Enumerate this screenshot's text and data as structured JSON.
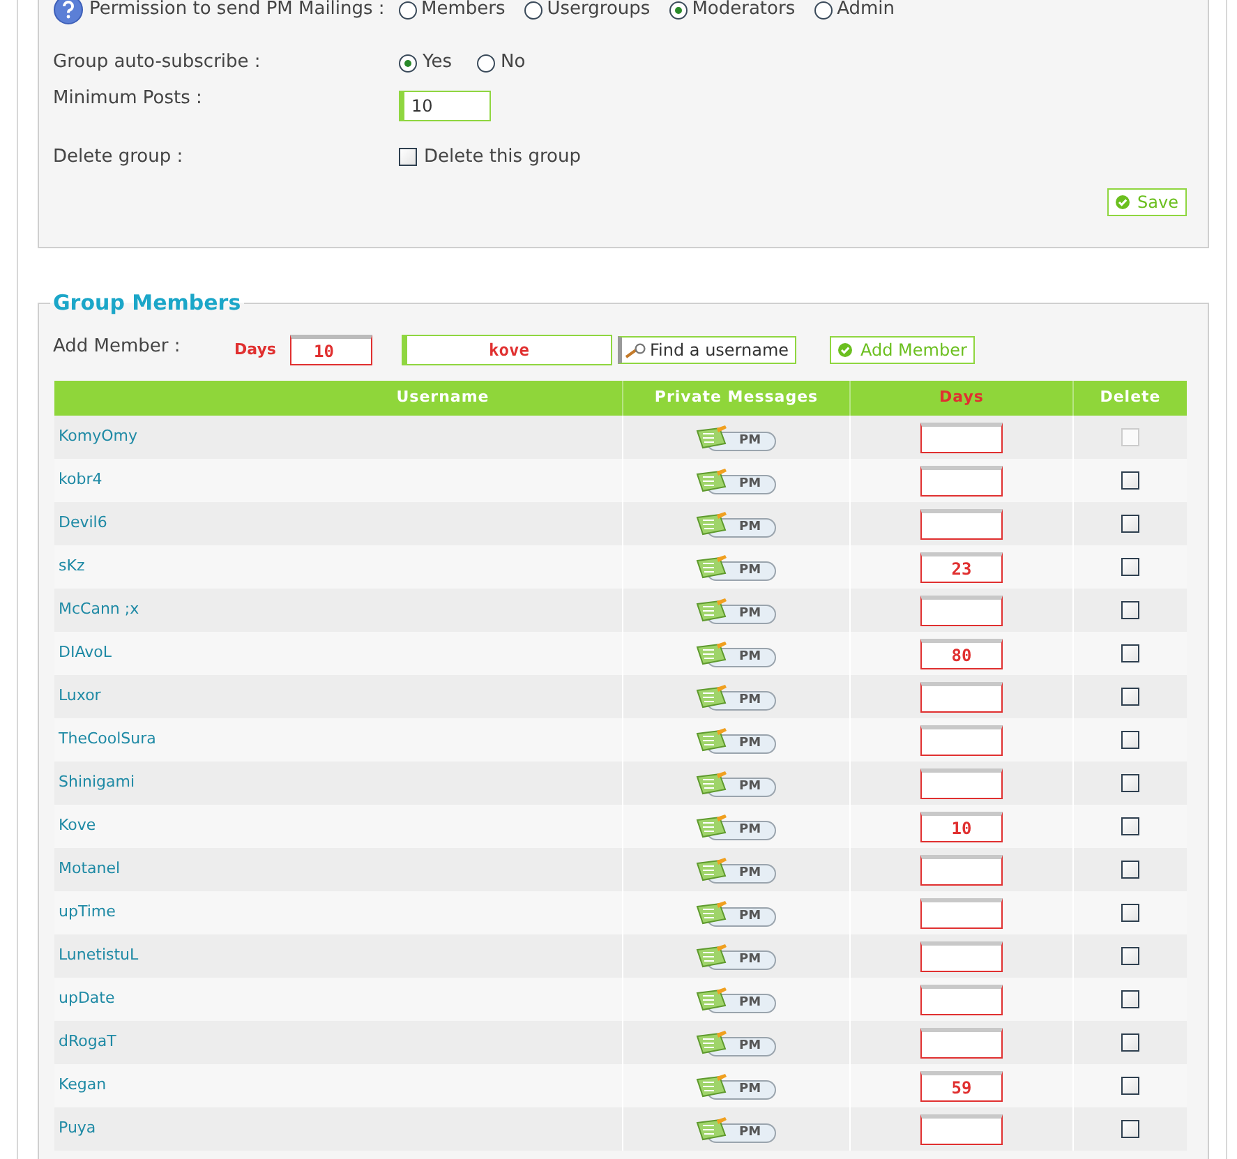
{
  "settings": {
    "permission": {
      "label": "Permission to send PM Mailings :",
      "options": [
        {
          "label": "Members",
          "selected": false
        },
        {
          "label": "Usergroups",
          "selected": false
        },
        {
          "label": "Moderators",
          "selected": true
        },
        {
          "label": "Admin",
          "selected": false
        }
      ]
    },
    "auto_subscribe": {
      "label": "Group auto-subscribe :",
      "options": [
        {
          "label": "Yes",
          "selected": true
        },
        {
          "label": "No",
          "selected": false
        }
      ]
    },
    "minimum_posts": {
      "label": "Minimum Posts :",
      "value": "10"
    },
    "delete_group": {
      "label": "Delete group :",
      "checkbox_label": "Delete this group",
      "checked": false
    },
    "save_button": "Save"
  },
  "group_members": {
    "title": "Group Members",
    "add_member": {
      "label": "Add Member :",
      "days_label": "Days",
      "days_value": "10",
      "username_value": "kove",
      "find_button": "Find a username",
      "add_button": "Add Member"
    },
    "columns": [
      "Username",
      "Private Messages",
      "Days",
      "Delete"
    ],
    "rows": [
      {
        "username": "KomyOmy",
        "pm": "PM",
        "days": "",
        "checked": false,
        "disabled": true
      },
      {
        "username": "kobr4",
        "pm": "PM",
        "days": "",
        "checked": false,
        "disabled": false
      },
      {
        "username": "Devil6",
        "pm": "PM",
        "days": "",
        "checked": false,
        "disabled": false
      },
      {
        "username": "sKz",
        "pm": "PM",
        "days": "23",
        "checked": false,
        "disabled": false
      },
      {
        "username": "McCann ;x",
        "pm": "PM",
        "days": "",
        "checked": false,
        "disabled": false
      },
      {
        "username": "DIAvoL",
        "pm": "PM",
        "days": "80",
        "checked": false,
        "disabled": false
      },
      {
        "username": "Luxor",
        "pm": "PM",
        "days": "",
        "checked": false,
        "disabled": false
      },
      {
        "username": "TheCoolSura",
        "pm": "PM",
        "days": "",
        "checked": false,
        "disabled": false
      },
      {
        "username": "Shinigami",
        "pm": "PM",
        "days": "",
        "checked": false,
        "disabled": false
      },
      {
        "username": "Kove",
        "pm": "PM",
        "days": "10",
        "checked": false,
        "disabled": false
      },
      {
        "username": "Motanel",
        "pm": "PM",
        "days": "",
        "checked": false,
        "disabled": false
      },
      {
        "username": "upTime",
        "pm": "PM",
        "days": "",
        "checked": false,
        "disabled": false
      },
      {
        "username": "LunetistuL",
        "pm": "PM",
        "days": "",
        "checked": false,
        "disabled": false
      },
      {
        "username": "upDate",
        "pm": "PM",
        "days": "",
        "checked": false,
        "disabled": false
      },
      {
        "username": "dRogaT",
        "pm": "PM",
        "days": "",
        "checked": false,
        "disabled": false
      },
      {
        "username": "Kegan",
        "pm": "PM",
        "days": "59",
        "checked": false,
        "disabled": false
      },
      {
        "username": "Puya",
        "pm": "PM",
        "days": "",
        "checked": false,
        "disabled": false
      }
    ]
  }
}
